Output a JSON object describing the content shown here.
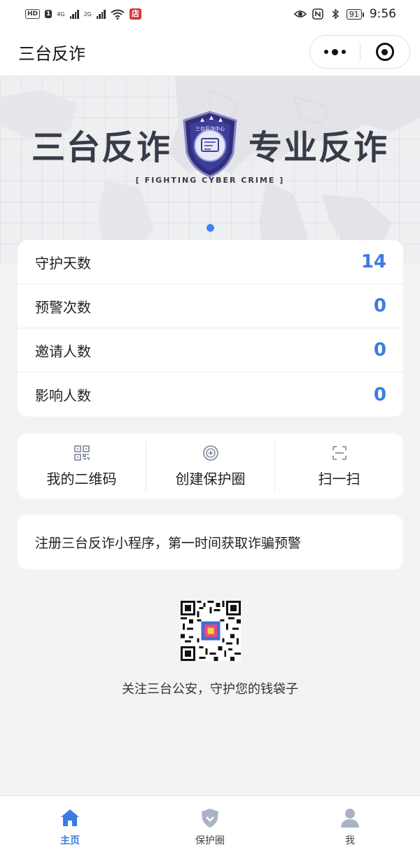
{
  "status_bar": {
    "hd_chip": "HD",
    "sim_chip": "1",
    "net1_top": "4G",
    "net1_bottom": "",
    "net2_top": "2G",
    "store_badge": "店",
    "battery": "91",
    "time": "9:56"
  },
  "header": {
    "title": "三台反诈",
    "more_icon": "more-dots-icon",
    "close_icon": "target-close-icon"
  },
  "banner": {
    "left_text": "三台反诈",
    "right_text": "专业反诈",
    "badge_text": "三台反诈中心",
    "subtitle": "[ FIGHTING CYBER CRIME ]",
    "active_slide_color": "#3b82f6"
  },
  "stats": [
    {
      "label": "守护天数",
      "value": "14"
    },
    {
      "label": "预警次数",
      "value": "0"
    },
    {
      "label": "邀请人数",
      "value": "0"
    },
    {
      "label": "影响人数",
      "value": "0"
    }
  ],
  "actions": [
    {
      "label": "我的二维码",
      "icon": "qrcode-icon"
    },
    {
      "label": "创建保护圈",
      "icon": "add-circle-icon"
    },
    {
      "label": "扫一扫",
      "icon": "scan-icon"
    }
  ],
  "notice": "注册三台反诈小程序，第一时间获取诈骗预警",
  "qr_caption": "关注三台公安，守护您的钱袋子",
  "tabs": [
    {
      "label": "主页",
      "icon": "home-icon",
      "active": true
    },
    {
      "label": "保护圈",
      "icon": "shield-icon",
      "active": false
    },
    {
      "label": "我",
      "icon": "person-icon",
      "active": false
    }
  ],
  "colors": {
    "accent": "#3b7ce0",
    "background": "#f2f3f5",
    "tab_inactive_icon": "#a9b3c4"
  }
}
